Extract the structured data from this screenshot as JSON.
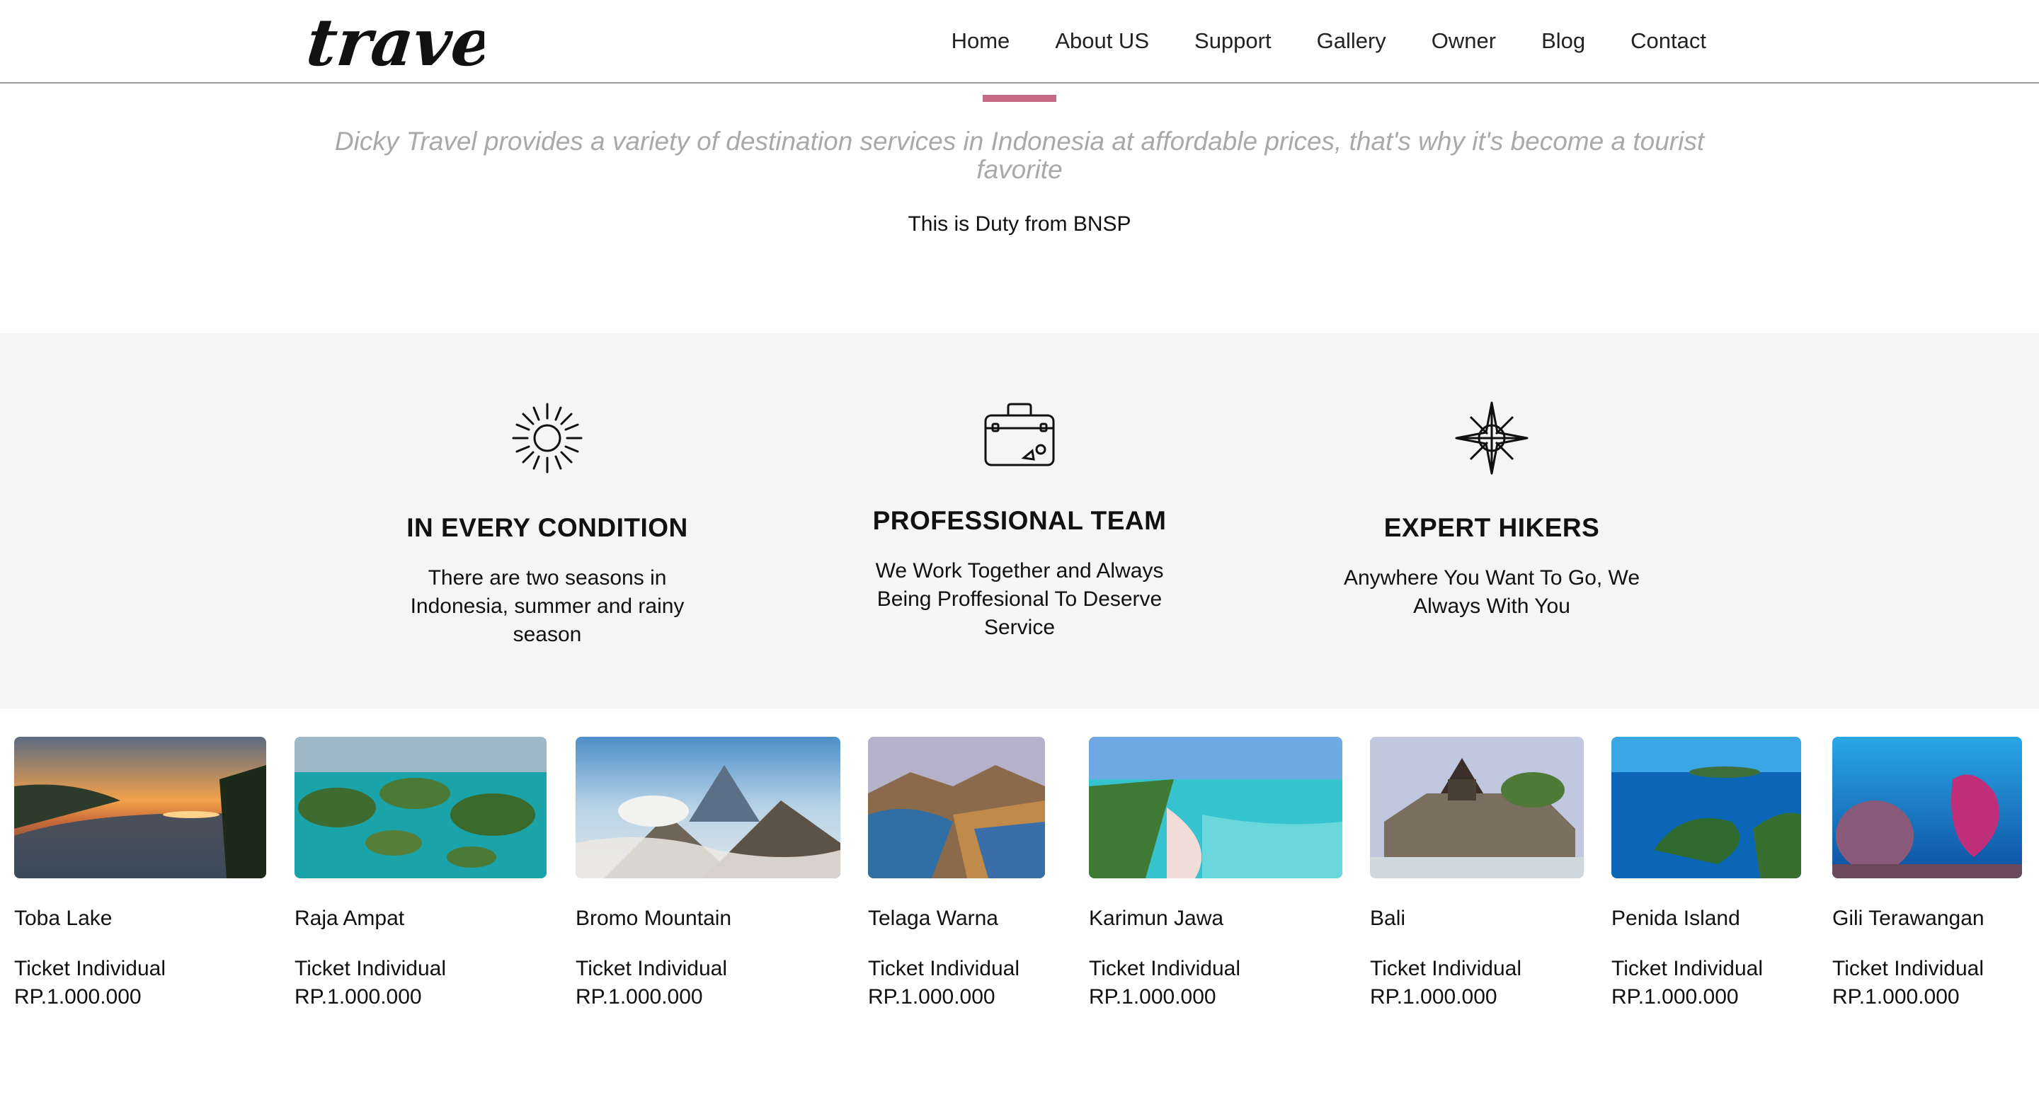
{
  "brand": {
    "logo_text": "travel"
  },
  "nav": {
    "items": [
      "Home",
      "About US",
      "Support",
      "Gallery",
      "Owner",
      "Blog",
      "Contact"
    ]
  },
  "intro": {
    "tagline": "Dicky Travel provides a variety of destination services in Indonesia at affordable prices, that's why it's become a tourist favorite",
    "subline": "This is Duty from BNSP"
  },
  "features": [
    {
      "icon": "sun-icon",
      "title": "IN EVERY CONDITION",
      "text": "There are two seasons in Indonesia, summer and rainy season"
    },
    {
      "icon": "suitcase-icon",
      "title": "PROFESSIONAL TEAM",
      "text": "We Work Together and Always Being Proffesional To Deserve Service"
    },
    {
      "icon": "compass-icon",
      "title": "EXPERT HIKERS",
      "text": "Anywhere You Want To Go, We Always With You"
    }
  ],
  "destinations": [
    {
      "name": "Toba Lake",
      "ticket": "Ticket Individual",
      "price": "RP.1.000.000"
    },
    {
      "name": "Raja Ampat",
      "ticket": "Ticket Individual",
      "price": "RP.1.000.000"
    },
    {
      "name": "Bromo Mountain",
      "ticket": "Ticket Individual",
      "price": "RP.1.000.000"
    },
    {
      "name": "Telaga Warna",
      "ticket": "Ticket Individual",
      "price": "RP.1.000.000"
    },
    {
      "name": "Karimun Jawa",
      "ticket": "Ticket Individual",
      "price": "RP.1.000.000"
    },
    {
      "name": "Bali",
      "ticket": "Ticket Individual",
      "price": "RP.1.000.000"
    },
    {
      "name": "Penida Island",
      "ticket": "Ticket Individual",
      "price": "RP.1.000.000"
    },
    {
      "name": "Gili Terawangan",
      "ticket": "Ticket Individual",
      "price": "RP.1.000.000"
    }
  ],
  "colors": {
    "accent": "#c46a87",
    "feature_bg": "#f4f5f4",
    "tagline": "#a9a9a9"
  }
}
